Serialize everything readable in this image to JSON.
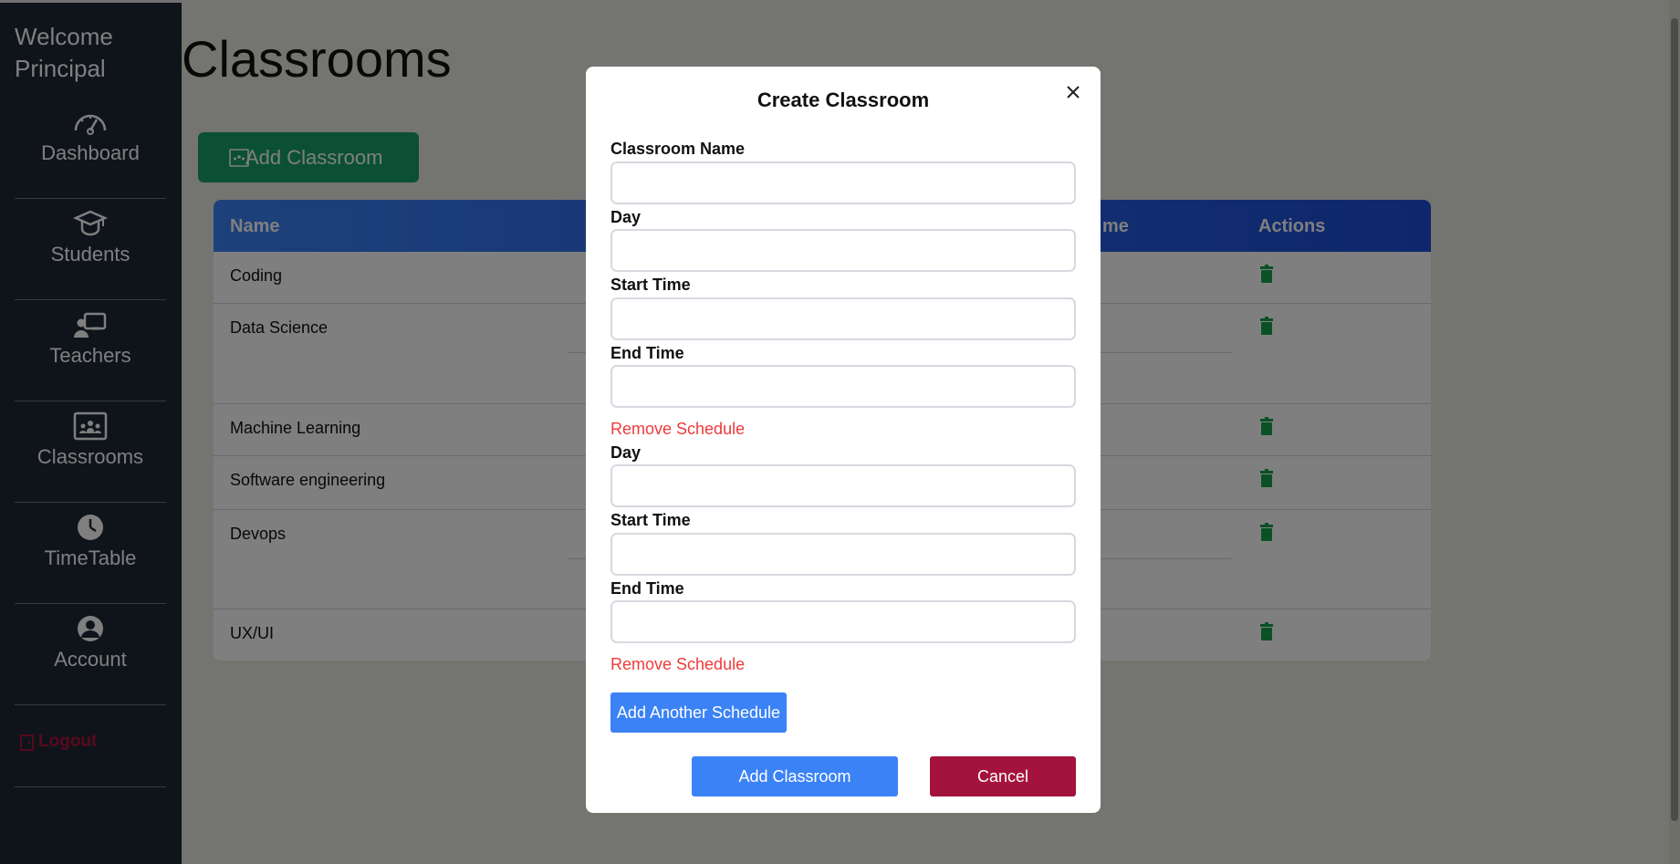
{
  "sidebar": {
    "welcome_line1": "Welcome",
    "welcome_line2": "Principal",
    "items": [
      {
        "label": "Dashboard",
        "icon": "gauge-icon"
      },
      {
        "label": "Students",
        "icon": "graduation-cap-icon"
      },
      {
        "label": "Teachers",
        "icon": "chalkboard-teacher-icon"
      },
      {
        "label": "Classrooms",
        "icon": "classroom-icon"
      },
      {
        "label": "TimeTable",
        "icon": "clock-icon"
      },
      {
        "label": "Account",
        "icon": "user-circle-icon"
      }
    ],
    "logout_label": "Logout"
  },
  "main": {
    "title": "Classrooms",
    "add_button_label": "Add Classroom",
    "table": {
      "headers": {
        "name": "Name",
        "partial_time": "me",
        "actions": "Actions"
      },
      "rows": [
        {
          "name": "Coding"
        },
        {
          "name": "Data Science"
        },
        {
          "name": "Machine Learning"
        },
        {
          "name": "Software engineering"
        },
        {
          "name": "Devops"
        },
        {
          "name": "UX/UI"
        }
      ]
    }
  },
  "modal": {
    "title": "Create Classroom",
    "classroom_name_label": "Classroom Name",
    "schedule_1": {
      "day_label": "Day",
      "start_label": "Start Time",
      "end_label": "End Time",
      "remove_label": "Remove Schedule"
    },
    "schedule_2": {
      "day_label": "Day",
      "start_label": "Start Time",
      "end_label": "End Time",
      "remove_label": "Remove Schedule"
    },
    "add_schedule_label": "Add Another Schedule",
    "submit_label": "Add Classroom",
    "cancel_label": "Cancel"
  },
  "colors": {
    "sidebar_bg": "#1f2937",
    "primary_blue": "#3b82f6",
    "cancel_red": "#a4133c",
    "remove_red": "#ef3a3a",
    "add_green": "#16a06b",
    "trash_green": "#15a34a",
    "logout_red": "#b3123a"
  }
}
